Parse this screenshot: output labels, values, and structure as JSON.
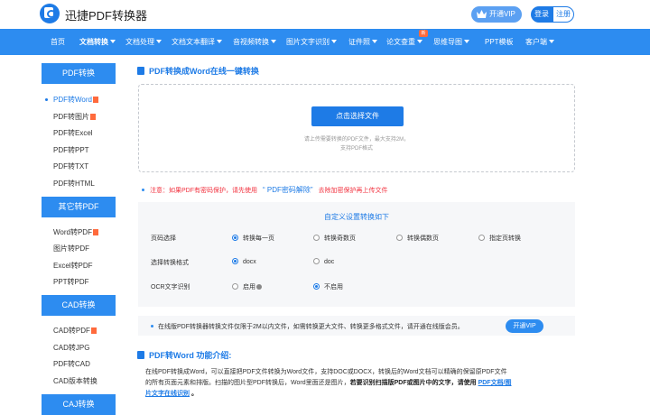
{
  "header": {
    "logo_text": "迅捷PDF转换器",
    "vip_label": "开通VIP",
    "login_label": "登录",
    "register_label": "注册"
  },
  "nav": {
    "items": [
      {
        "label": "首页",
        "dropdown": false
      },
      {
        "label": "文档转换",
        "dropdown": true
      },
      {
        "label": "文档处理",
        "dropdown": true
      },
      {
        "label": "文档文本翻译",
        "dropdown": true
      },
      {
        "label": "音视频转换",
        "dropdown": true
      },
      {
        "label": "图片文字识别",
        "dropdown": true
      },
      {
        "label": "证件照",
        "dropdown": true
      },
      {
        "label": "论文查重",
        "dropdown": true
      },
      {
        "label": "思维导图",
        "dropdown": true
      },
      {
        "label": "PPT模板",
        "dropdown": false
      },
      {
        "label": "客户端",
        "dropdown": true
      }
    ],
    "new_badge": "新"
  },
  "sidebar": {
    "sections": [
      {
        "title": "PDF转换",
        "items": [
          "PDF转Word",
          "PDF转图片",
          "PDF转Excel",
          "PDF转PPT",
          "PDF转TXT",
          "PDF转HTML"
        ]
      },
      {
        "title": "其它转PDF",
        "items": [
          "Word转PDF",
          "图片转PDF",
          "Excel转PDF",
          "PPT转PDF"
        ]
      },
      {
        "title": "CAD转换",
        "items": [
          "CAD转PDF",
          "CAD转JPG",
          "PDF转CAD",
          "CAD版本转换"
        ]
      },
      {
        "title": "CAJ转换",
        "items": []
      }
    ]
  },
  "main": {
    "title": "PDF转换成Word在线一键转换",
    "upload": {
      "button": "点击选择文件",
      "hint1": "请上传需要转换的PDF文件，最大支持2M，",
      "hint2": "支持PDF格式"
    },
    "notice": {
      "before": "注意：如果PDF有密码保护，请先使用",
      "link": "“ PDF密码解除”",
      "after": "去除加密保护再上传文件"
    },
    "settings": {
      "title": "自定义设置转换如下",
      "page_label": "页码选择",
      "page_options": [
        "转换每一页",
        "转换奇数页",
        "转换偶数页",
        "指定页转换"
      ],
      "format_label": "选择转换格式",
      "format_options": [
        "docx",
        "doc"
      ],
      "ocr_label": "OCR文字识别",
      "ocr_options": [
        "启用",
        "不启用"
      ]
    },
    "limit": {
      "text": "在线版PDF转换器转换文件仅限于2M以内文件，如需转换更大文件、转换更多格式文件，请开通在线版会员。",
      "button": "开通VIP"
    },
    "intro": {
      "title": "PDF转Word 功能介绍:",
      "line1": "在线PDF转换成Word，可以直接把PDF文件转换为Word文件，支持DOC或DOCX，转换后的Word文档可以精确的保留原PDF文件",
      "line2a": "的所有页面元素和排版。扫描的图片型PDF转换后，Word里面还是图片，",
      "line2b": "若要识别扫描版PDF或图片中的文字，请使用",
      "link1": "PDF文档/图",
      "link2": "片文字在线识别",
      "end": "。"
    }
  },
  "colors": {
    "brand": "#2d8cf0",
    "accent": "#1e7be6",
    "warning": "#f2323f",
    "hot": "#ff6a3c"
  }
}
